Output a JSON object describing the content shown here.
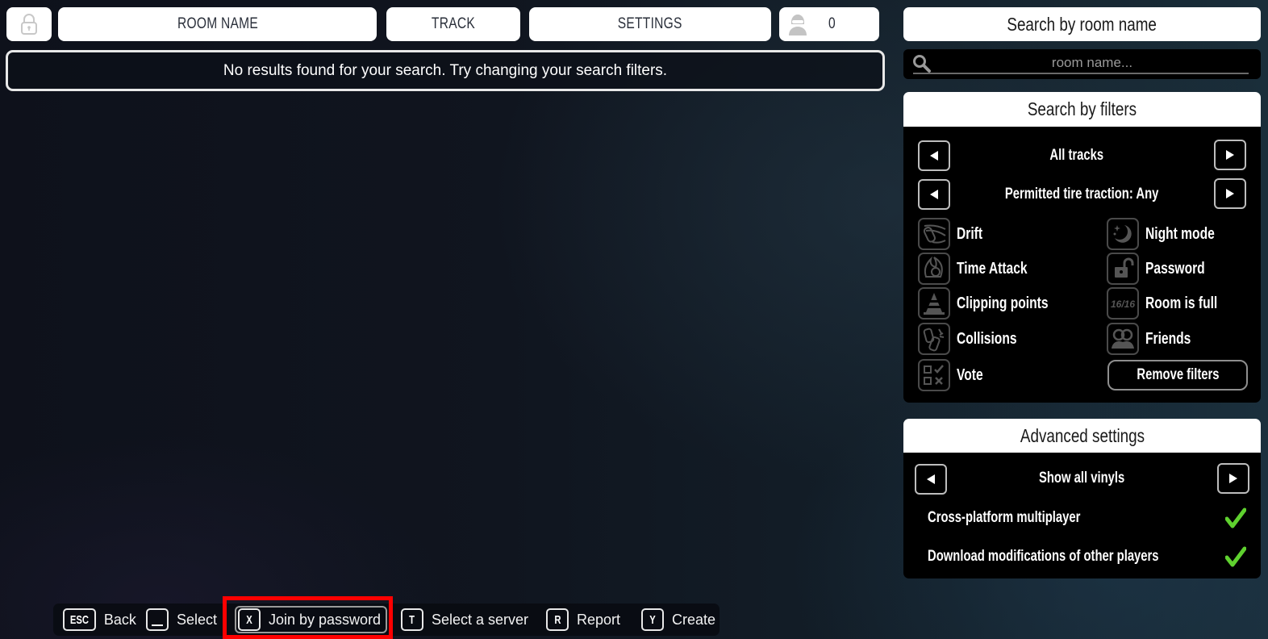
{
  "header": {
    "lock_icon": "padlock-icon",
    "room_name": "ROOM NAME",
    "track": "TRACK",
    "settings": "SETTINGS",
    "players_icon": "driver-helmet-icon",
    "players_count": "0"
  },
  "results": {
    "message": "No results found for your search. Try changing your search filters."
  },
  "search": {
    "title": "Search by room name",
    "placeholder": "room name...",
    "value": "",
    "icon": "search-icon"
  },
  "filters": {
    "title": "Search by filters",
    "track_selector": "All tracks",
    "traction_selector": "Permitted tire traction: Any",
    "left": [
      {
        "label": "Drift",
        "icon": "drift-icon"
      },
      {
        "label": "Time Attack",
        "icon": "time-attack-icon"
      },
      {
        "label": "Clipping points",
        "icon": "traffic-cone-icon"
      },
      {
        "label": "Collisions",
        "icon": "collision-icon"
      },
      {
        "label": "Vote",
        "icon": "vote-icon"
      }
    ],
    "right": [
      {
        "label": "Night mode",
        "icon": "moon-icon"
      },
      {
        "label": "Password",
        "icon": "unlock-icon"
      },
      {
        "label": "Room is full",
        "icon": "room-full-icon",
        "icon_text": "16/16"
      },
      {
        "label": "Friends",
        "icon": "friends-icon"
      }
    ],
    "remove_label": "Remove filters"
  },
  "advanced": {
    "title": "Advanced settings",
    "vinyl_selector": "Show all vinyls",
    "options": [
      {
        "label": "Cross-platform multiplayer",
        "checked": true
      },
      {
        "label": "Download modifications of other players",
        "checked": true
      }
    ],
    "check_color": "#5fd12f"
  },
  "hints": [
    {
      "key": "ESC",
      "label": "Back"
    },
    {
      "key": "␣",
      "label": "Select"
    },
    {
      "key": "X",
      "label": "Join by password",
      "highlighted": true
    },
    {
      "key": "T",
      "label": "Select a server"
    },
    {
      "key": "R",
      "label": "Report"
    },
    {
      "key": "Y",
      "label": "Create"
    }
  ],
  "highlight_color": "#ff0000"
}
